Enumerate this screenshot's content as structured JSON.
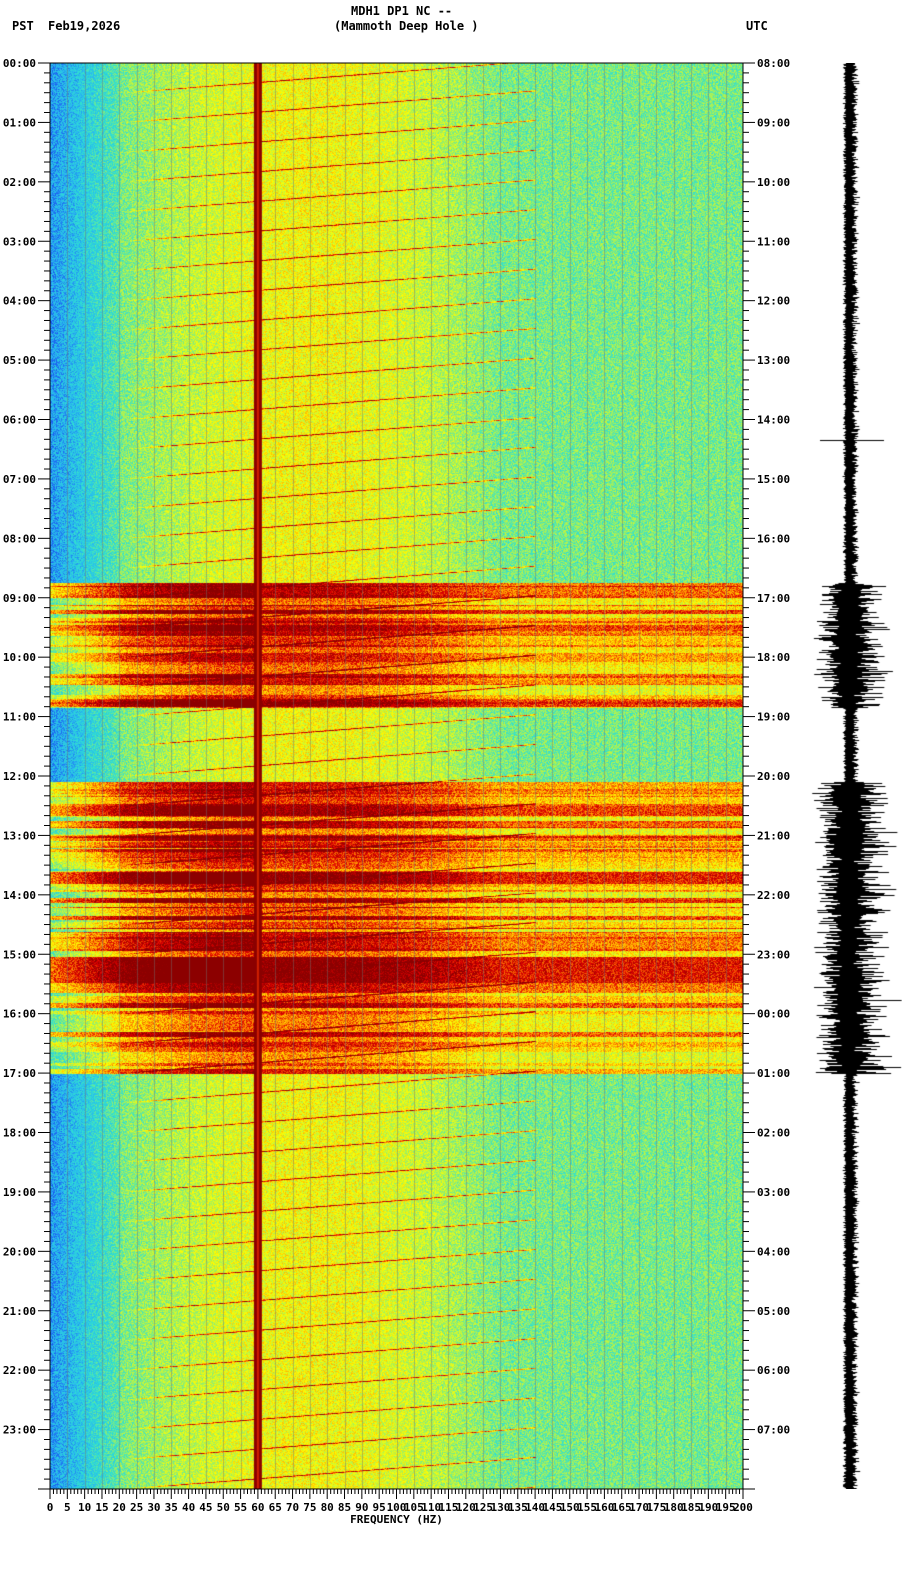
{
  "header": {
    "title": "MDH1 DP1 NC --",
    "subtitle": "(Mammoth Deep Hole )",
    "left_tz": "PST",
    "date": "Feb19,2026",
    "right_tz": "UTC"
  },
  "chart_data": {
    "type": "heatmap",
    "title": "MDH1 DP1 NC --",
    "subtitle": "(Mammoth Deep Hole )",
    "xlabel": "FREQUENCY (HZ)",
    "ylabel": "",
    "xlim": [
      0,
      200
    ],
    "ylim_hours": [
      0,
      24
    ],
    "x_ticks": [
      "0",
      "5",
      "10",
      "15",
      "20",
      "25",
      "30",
      "35",
      "40",
      "45",
      "50",
      "55",
      "60",
      "65",
      "70",
      "75",
      "80",
      "85",
      "90",
      "95",
      "100",
      "105",
      "110",
      "115",
      "120",
      "125",
      "130",
      "135",
      "140",
      "145",
      "150",
      "155",
      "160",
      "165",
      "170",
      "175",
      "180",
      "185",
      "190",
      "195",
      "200"
    ],
    "y_ticks_left": [
      "00:00",
      "01:00",
      "02:00",
      "03:00",
      "04:00",
      "05:00",
      "06:00",
      "07:00",
      "08:00",
      "09:00",
      "10:00",
      "11:00",
      "12:00",
      "13:00",
      "14:00",
      "15:00",
      "16:00",
      "17:00",
      "18:00",
      "19:00",
      "20:00",
      "21:00",
      "22:00",
      "23:00"
    ],
    "y_ticks_right": [
      "08:00",
      "09:00",
      "10:00",
      "11:00",
      "12:00",
      "13:00",
      "14:00",
      "15:00",
      "16:00",
      "17:00",
      "18:00",
      "19:00",
      "20:00",
      "21:00",
      "22:00",
      "23:00",
      "00:00",
      "01:00",
      "02:00",
      "03:00",
      "04:00",
      "05:00",
      "06:00",
      "07:00"
    ],
    "constant_line_hz": 60,
    "high_energy_intervals_hours": [
      [
        8.75,
        10.85
      ],
      [
        12.1,
        17.0
      ]
    ],
    "colormap": [
      "#1a50f0",
      "#28b8f0",
      "#30e0d0",
      "#a0f060",
      "#ffff00",
      "#ff9000",
      "#e00000",
      "#8b0000"
    ]
  }
}
